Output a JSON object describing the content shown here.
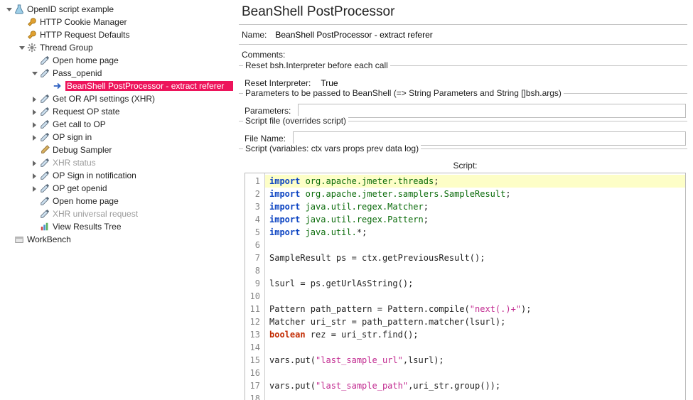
{
  "tree": [
    {
      "ind": 0,
      "tw": "down",
      "ic": "flask",
      "lbl": "OpenID script example"
    },
    {
      "ind": 1,
      "tw": "",
      "ic": "wrench",
      "lbl": "HTTP Cookie Manager"
    },
    {
      "ind": 1,
      "tw": "",
      "ic": "wrench",
      "lbl": "HTTP Request Defaults"
    },
    {
      "ind": 1,
      "tw": "down",
      "ic": "gear",
      "lbl": "Thread Group"
    },
    {
      "ind": 2,
      "tw": "",
      "ic": "pipette",
      "lbl": "Open home page"
    },
    {
      "ind": 2,
      "tw": "down",
      "ic": "pipette",
      "lbl": "Pass_openid"
    },
    {
      "ind": 3,
      "tw": "",
      "ic": "arrow",
      "lbl": "BeanShell PostProcessor - extract referer",
      "sel": true
    },
    {
      "ind": 2,
      "tw": "right",
      "ic": "pipette",
      "lbl": "Get OR API settings (XHR)"
    },
    {
      "ind": 2,
      "tw": "right",
      "ic": "pipette",
      "lbl": "Request OP state"
    },
    {
      "ind": 2,
      "tw": "right",
      "ic": "pipette",
      "lbl": "Get call to OP"
    },
    {
      "ind": 2,
      "tw": "right",
      "ic": "pipette",
      "lbl": "OP sign in"
    },
    {
      "ind": 2,
      "tw": "",
      "ic": "pencil",
      "lbl": "Debug Sampler"
    },
    {
      "ind": 2,
      "tw": "right",
      "ic": "pipette",
      "lbl": "XHR status",
      "dim": true
    },
    {
      "ind": 2,
      "tw": "right",
      "ic": "pipette",
      "lbl": "OP Sign in notification"
    },
    {
      "ind": 2,
      "tw": "right",
      "ic": "pipette",
      "lbl": "OP get openid"
    },
    {
      "ind": 2,
      "tw": "",
      "ic": "pipette",
      "lbl": "Open home page"
    },
    {
      "ind": 2,
      "tw": "",
      "ic": "pipette",
      "lbl": "XHR universal request",
      "dim": true
    },
    {
      "ind": 2,
      "tw": "",
      "ic": "chart",
      "lbl": "View Results Tree"
    },
    {
      "ind": 0,
      "tw": "",
      "ic": "box",
      "lbl": "WorkBench"
    }
  ],
  "title": "BeanShell PostProcessor",
  "name_label": "Name:",
  "name_value": "BeanShell PostProcessor - extract referer",
  "comments_label": "Comments:",
  "comments_value": "",
  "reset_group": "Reset bsh.Interpreter before each call",
  "reset_label": "Reset Interpreter:",
  "reset_value": "True",
  "params_group": "Parameters to be passed to BeanShell (=> String Parameters and String []bsh.args)",
  "params_label": "Parameters:",
  "params_value": "",
  "file_group": "Script file (overrides script)",
  "file_label": "File Name:",
  "file_value": "",
  "script_group": "Script (variables: ctx vars props prev data log)",
  "script_head": "Script:",
  "code": [
    {
      "hl": true,
      "t": [
        [
          "kw",
          "import"
        ],
        [
          "pk",
          " org.apache.jmeter.threads"
        ],
        [
          "",
          ";"
        ]
      ]
    },
    {
      "t": [
        [
          "kw",
          "import"
        ],
        [
          "pk",
          " org.apache.jmeter.samplers.SampleResult"
        ],
        [
          "",
          ";"
        ]
      ]
    },
    {
      "t": [
        [
          "kw",
          "import"
        ],
        [
          "pk",
          " java.util.regex.Matcher"
        ],
        [
          "",
          ";"
        ]
      ]
    },
    {
      "t": [
        [
          "kw",
          "import"
        ],
        [
          "pk",
          " java.util.regex.Pattern"
        ],
        [
          "",
          ";"
        ]
      ]
    },
    {
      "t": [
        [
          "kw",
          "import"
        ],
        [
          "pk",
          " java.util."
        ],
        [
          "",
          "*;"
        ]
      ]
    },
    {
      "t": [
        [
          "",
          ""
        ]
      ]
    },
    {
      "t": [
        [
          "",
          "SampleResult ps = ctx.getPreviousResult();"
        ]
      ]
    },
    {
      "t": [
        [
          "",
          ""
        ]
      ]
    },
    {
      "t": [
        [
          "",
          "lsurl = ps.getUrlAsString();"
        ]
      ]
    },
    {
      "t": [
        [
          "",
          ""
        ]
      ]
    },
    {
      "t": [
        [
          "",
          "Pattern path_pattern = Pattern.compile("
        ],
        [
          "str",
          "\"next(.)+\""
        ],
        [
          "",
          ");"
        ]
      ]
    },
    {
      "t": [
        [
          "",
          "Matcher uri_str = path_pattern.matcher(lsurl);"
        ]
      ]
    },
    {
      "t": [
        [
          "bool",
          "boolean"
        ],
        [
          "",
          " rez = uri_str.find();"
        ]
      ]
    },
    {
      "t": [
        [
          "",
          ""
        ]
      ]
    },
    {
      "t": [
        [
          "",
          "vars.put("
        ],
        [
          "str",
          "\"last_sample_url\""
        ],
        [
          "",
          ",lsurl);"
        ]
      ]
    },
    {
      "t": [
        [
          "",
          ""
        ]
      ]
    },
    {
      "t": [
        [
          "",
          "vars.put("
        ],
        [
          "str",
          "\"last_sample_path\""
        ],
        [
          "",
          ",uri_str.group());"
        ]
      ]
    },
    {
      "t": [
        [
          "",
          ""
        ]
      ]
    }
  ]
}
